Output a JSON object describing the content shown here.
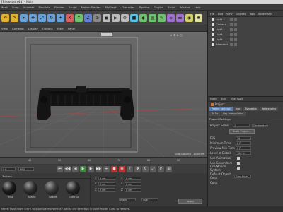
{
  "window": {
    "title": "[Rheostat.c4d] - Main"
  },
  "menubar": [
    "Mesh",
    "Snap",
    "Animate",
    "Simulate",
    "Render",
    "Sculpt",
    "Motion Tracker",
    "MoGraph",
    "Character",
    "Pipeline",
    "Plugins",
    "Script",
    "Window",
    "Help"
  ],
  "viewport": {
    "menu": [
      "View",
      "Cameras",
      "Display",
      "Options",
      "Filter",
      "Panel"
    ],
    "grid_spacing": "Grid Spacing : 1000 cm",
    "grid_label": "Grid Spacing"
  },
  "timeline": {
    "ticks": [
      "40",
      "50",
      "60",
      "70",
      "80",
      "90"
    ],
    "frame_value": "0 F",
    "end_value": "90 F"
  },
  "material": {
    "tab": "Texture",
    "items": [
      {
        "name": "Mat",
        "color": "#1a1a1a"
      },
      {
        "name": "Bakelit",
        "color": "#2e2e2e"
      },
      {
        "name": "Bakelit",
        "color": "#3a3a3a"
      },
      {
        "name": "Dark Gr",
        "color": "#262626"
      }
    ]
  },
  "coord": {
    "rows": [
      {
        "label": "X",
        "value": "0 cm"
      },
      {
        "label": "Y",
        "value": "0 cm"
      },
      {
        "label": "Z",
        "value": "0 cm"
      }
    ],
    "apply_label": "Apply",
    "world_label": "World",
    "size_label": "Size"
  },
  "objects": {
    "header": [
      "File",
      "Edit",
      "View",
      "Objects",
      "Tags",
      "Bookmarks"
    ],
    "items": [
      {
        "name": "Light.1"
      },
      {
        "name": "Camera"
      },
      {
        "name": "Light.1"
      },
      {
        "name": "Light"
      },
      {
        "name": "Light"
      },
      {
        "name": "Rheostat"
      }
    ]
  },
  "attributes": {
    "header": [
      "Mode",
      "Edit",
      "User Data"
    ],
    "object_label": "Project",
    "tabs": [
      "Project Settings",
      "Info",
      "Dynamics",
      "Referencing"
    ],
    "subtabs": [
      "To Do",
      "Key Interpolation"
    ],
    "section": "Project Settings",
    "project_scale_label": "Project Scale",
    "project_scale_value": "1",
    "project_scale_unit": "Centimeters",
    "scale_button": "Scale Project...",
    "rows": [
      {
        "label": "FPS",
        "value": "30"
      },
      {
        "label": "Minimum Time",
        "value": "0 F"
      },
      {
        "label": "Preview Min Time",
        "value": "0 F"
      },
      {
        "label": "Level of Detail",
        "value": "100 %"
      },
      {
        "label": "Use Animation",
        "value": ""
      },
      {
        "label": "Use Generators",
        "value": ""
      },
      {
        "label": "Use Motion System",
        "value": ""
      }
    ],
    "default_color_label": "Default Object Color",
    "default_color_value": "Gray-Blue",
    "color_label": "Color"
  },
  "status": "Move: Hold down SHIFT to quantize movement / add to the selection in point mode, CTRL to remove."
}
